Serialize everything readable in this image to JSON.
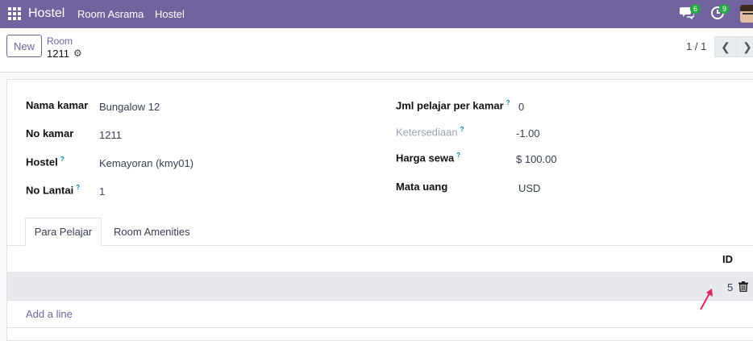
{
  "topbar": {
    "brand": "Hostel",
    "menu": [
      "Room Asrama",
      "Hostel"
    ],
    "messages_count": "6",
    "activities_count": "9"
  },
  "control": {
    "new_label": "New",
    "breadcrumb_parent": "Room",
    "breadcrumb_current": "1211",
    "pager": "1 / 1"
  },
  "form": {
    "left": [
      {
        "label": "Nama kamar",
        "value": "Bungalow 12",
        "help": ""
      },
      {
        "label": "No kamar",
        "value": "1211",
        "help": ""
      },
      {
        "label": "Hostel",
        "value": "Kemayoran (kmy01)",
        "help": "?"
      },
      {
        "label": "No Lantai",
        "value": "1",
        "help": "?"
      }
    ],
    "right": [
      {
        "label": "Jml pelajar per kamar",
        "value": "0",
        "help": "?"
      },
      {
        "label": "Ketersediaan",
        "value": "-1.00",
        "help": "?"
      },
      {
        "label": "Harga sewa",
        "value": "$ 100.00",
        "help": "?"
      },
      {
        "label": "Mata uang",
        "value": "USD",
        "help": ""
      }
    ]
  },
  "tabs": [
    "Para Pelajar",
    "Room Amenities"
  ],
  "table": {
    "header_id": "ID",
    "rows": [
      {
        "id": "5"
      }
    ],
    "add_line": "Add a line"
  },
  "colors": {
    "brand": "#71639e",
    "badge": "#28a745",
    "annotation_arrow": "#e0245e"
  }
}
